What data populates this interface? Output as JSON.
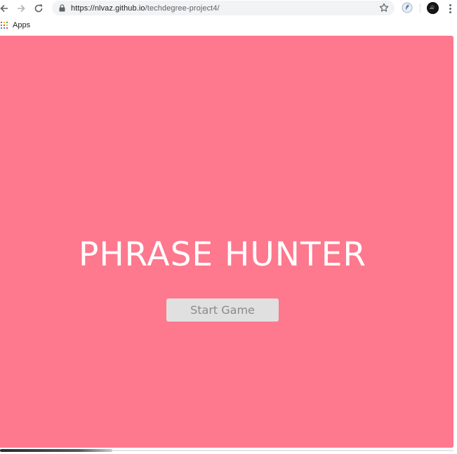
{
  "browser": {
    "url_host": "https://nlvaz.github.io",
    "url_path": "/techdegree-project4/",
    "bookmarks": {
      "apps_label": "Apps"
    },
    "icons": {
      "back": "back-arrow-icon",
      "forward": "forward-arrow-icon",
      "reload": "reload-icon",
      "lock": "lock-icon",
      "star": "star-icon",
      "extension": "extension-icon",
      "profile": "avatar",
      "menu": "kebab-menu-icon",
      "apps": "apps-grid-icon"
    }
  },
  "page": {
    "title": "PHRASE HUNTER",
    "start_button_label": "Start Game",
    "colors": {
      "background": "#fe788e",
      "title_text": "#ffffff",
      "button_bg": "#e0e0e0",
      "button_text": "#8a8a8a"
    }
  }
}
